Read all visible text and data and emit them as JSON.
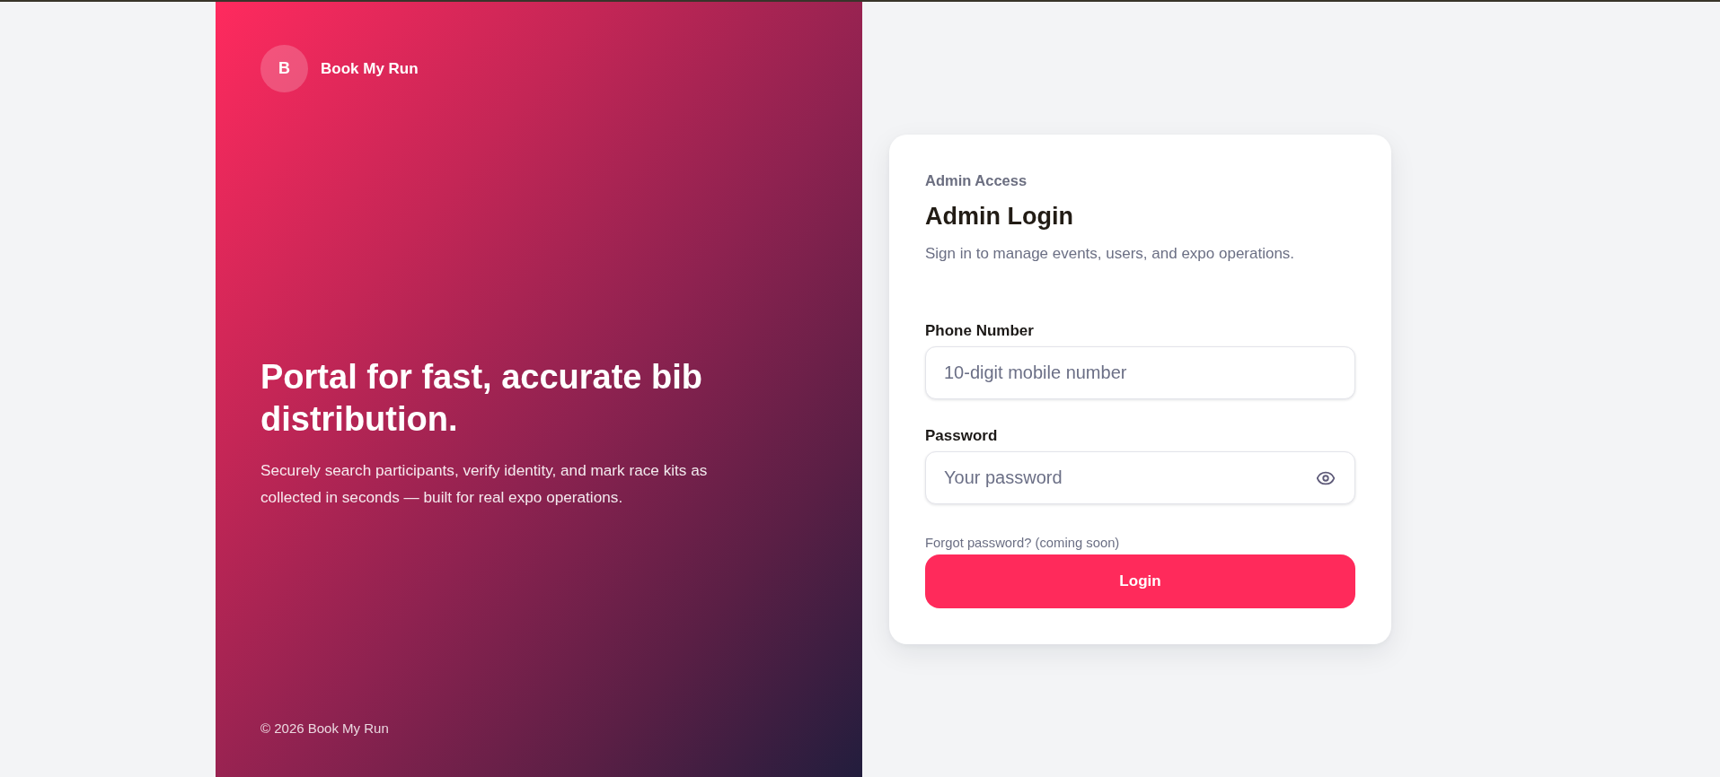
{
  "brand": {
    "logo_letter": "B",
    "name": "Book My Run"
  },
  "hero": {
    "headline": "Portal for fast, accurate bib distribution.",
    "description": "Securely search participants, verify identity, and mark race kits as collected in seconds — built for real expo operations."
  },
  "footer": {
    "copyright": "© 2026 Book My Run"
  },
  "login_card": {
    "eyebrow": "Admin Access",
    "title": "Admin Login",
    "subtitle": "Sign in to manage events, users, and expo operations.",
    "fields": [
      {
        "kind": "phone",
        "label": "Phone Number",
        "placeholder": "10-digit mobile number"
      },
      {
        "kind": "password",
        "label": "Password",
        "placeholder": "Your password"
      }
    ],
    "forgot_link": "Forgot password? (coming soon)",
    "submit": "Login"
  }
}
